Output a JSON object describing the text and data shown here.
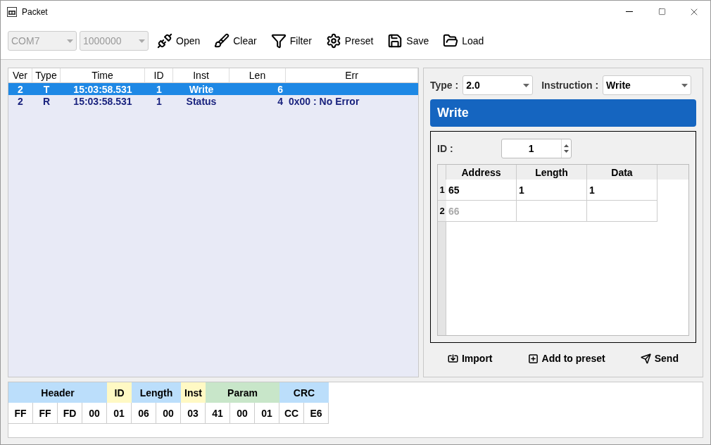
{
  "window": {
    "title": "Packet"
  },
  "toolbar": {
    "port": {
      "value": "COM7",
      "disabled": true
    },
    "baud": {
      "value": "1000000",
      "disabled": true
    },
    "buttons": [
      "Open",
      "Clear",
      "Filter",
      "Preset",
      "Save",
      "Load"
    ]
  },
  "packet_list": {
    "columns": [
      "Ver",
      "Type",
      "Time",
      "ID",
      "Inst",
      "Len",
      "Err"
    ],
    "rows": [
      {
        "cells": [
          "2",
          "T",
          "15:03:58.531",
          "1",
          "Write",
          "6",
          ""
        ],
        "selected": true
      },
      {
        "cells": [
          "2",
          "R",
          "15:03:58.531",
          "1",
          "Status",
          "4",
          "0x00 : No Error"
        ],
        "selected": false
      }
    ]
  },
  "editor": {
    "type_label": "Type :",
    "type_value": "2.0",
    "instruction_label": "Instruction :",
    "instruction_value": "Write",
    "banner": "Write",
    "id_label": "ID :",
    "id_value": "1",
    "columns": [
      "Address",
      "Length",
      "Data"
    ],
    "rows": [
      {
        "number": "1",
        "cells": [
          "65",
          "1",
          "1"
        ],
        "dimmed": false
      },
      {
        "number": "2",
        "cells": [
          "66",
          "",
          ""
        ],
        "dimmed": true
      }
    ],
    "buttons": [
      "Import",
      "Add to preset",
      "Send"
    ]
  },
  "packet_bytes": {
    "groups": [
      {
        "label": "Header",
        "color": "#bbdefb",
        "bytes": [
          "FF",
          "FF",
          "FD",
          "00"
        ]
      },
      {
        "label": "ID",
        "color": "#fff9c4",
        "bytes": [
          "01"
        ]
      },
      {
        "label": "Length",
        "color": "#bbdefb",
        "bytes": [
          "06",
          "00"
        ]
      },
      {
        "label": "Inst",
        "color": "#fff9c4",
        "bytes": [
          "03"
        ]
      },
      {
        "label": "Param",
        "color": "#c8e6c9",
        "bytes": [
          "41",
          "00",
          "01"
        ]
      },
      {
        "label": "CRC",
        "color": "#bbdefb",
        "bytes": [
          "CC",
          "E6"
        ]
      }
    ]
  }
}
